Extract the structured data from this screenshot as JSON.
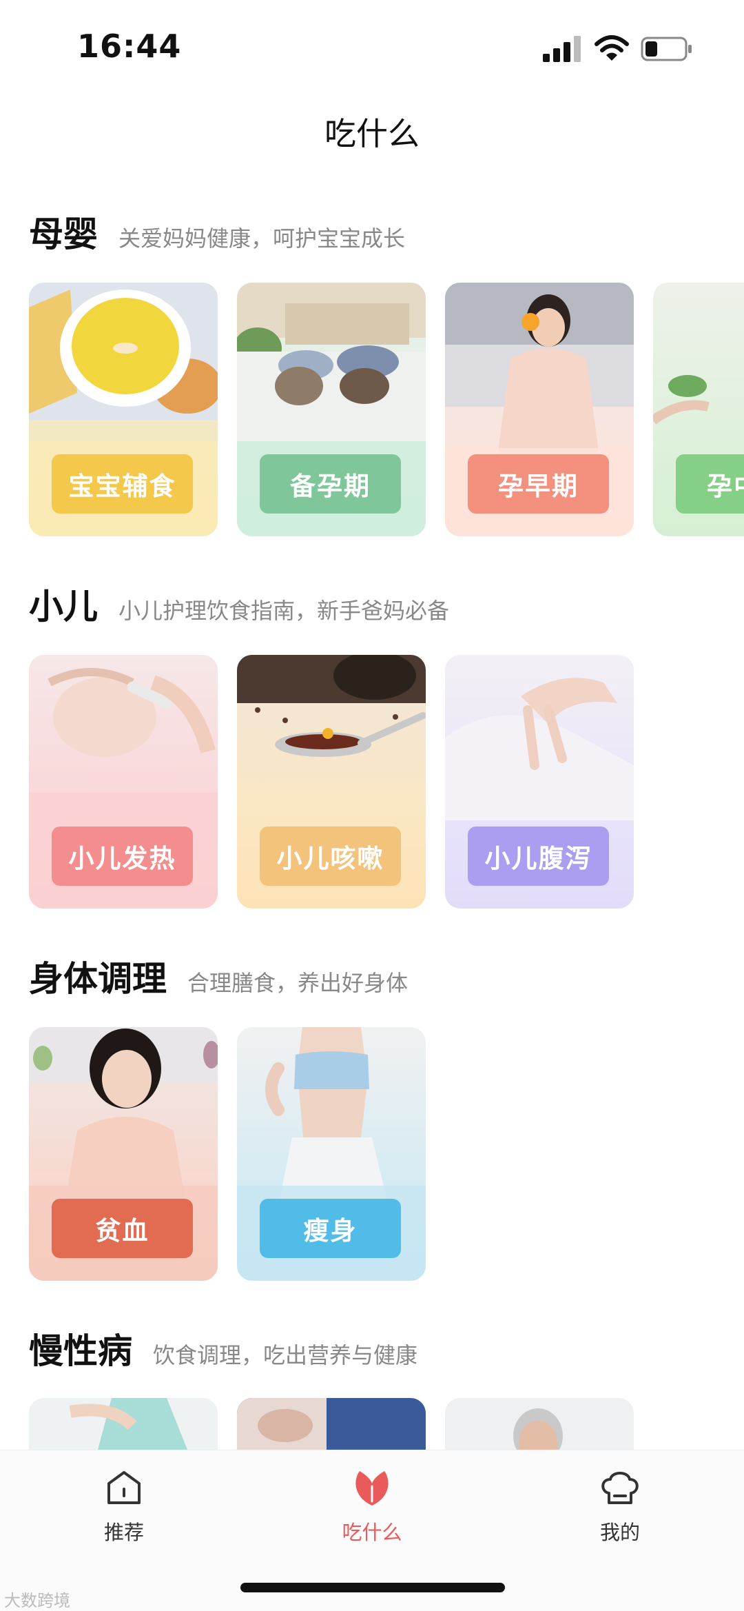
{
  "status_bar": {
    "time": "16:44"
  },
  "page": {
    "title": "吃什么"
  },
  "sections": [
    {
      "title": "母婴",
      "subtitle": "关爱妈妈健康，呵护宝宝成长",
      "cards": [
        {
          "label": "宝宝辅食",
          "color": "#f4c84a"
        },
        {
          "label": "备孕期",
          "color": "#7fc79a"
        },
        {
          "label": "孕早期",
          "color": "#f4907e"
        },
        {
          "label": "孕中",
          "color": "#85d086"
        }
      ]
    },
    {
      "title": "小儿",
      "subtitle": "小儿护理饮食指南，新手爸妈必备",
      "cards": [
        {
          "label": "小儿发热",
          "color": "#f48d8d"
        },
        {
          "label": "小儿咳嗽",
          "color": "#f3c27b"
        },
        {
          "label": "小儿腹泻",
          "color": "#ab9ef0"
        }
      ]
    },
    {
      "title": "身体调理",
      "subtitle": "合理膳食，养出好身体",
      "cards": [
        {
          "label": "贫血",
          "color": "#e26c52"
        },
        {
          "label": "瘦身",
          "color": "#52bce8"
        }
      ]
    },
    {
      "title": "慢性病",
      "subtitle": "饮食调理，吃出营养与健康",
      "cards": []
    }
  ],
  "bottom_nav": {
    "items": [
      {
        "label": "推荐",
        "icon": "home-icon"
      },
      {
        "label": "吃什么",
        "icon": "leaf-icon",
        "active": true
      },
      {
        "label": "我的",
        "icon": "chef-hat-icon"
      }
    ],
    "accent_color": "#ea5a5a"
  },
  "watermark": "大数跨境"
}
